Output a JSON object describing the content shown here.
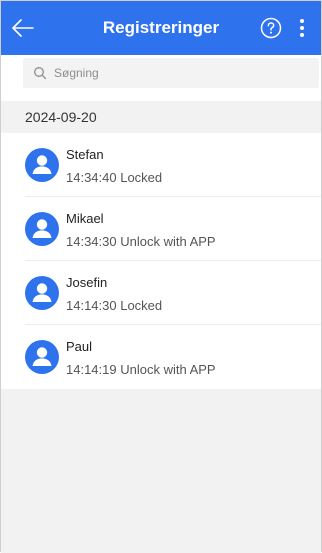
{
  "header": {
    "title": "Registreringer",
    "back_icon": "arrow-left-icon",
    "help_icon": "question-circle-icon",
    "more_icon": "more-vertical-icon",
    "background": "#2f72ee"
  },
  "search": {
    "placeholder": "Søgning",
    "value": ""
  },
  "group": {
    "date": "2024-09-20"
  },
  "records": [
    {
      "name": "Stefan",
      "detail": "14:34:40 Locked"
    },
    {
      "name": "Mikael",
      "detail": "14:34:30 Unlock with APP"
    },
    {
      "name": "Josefin",
      "detail": "14:14:30 Locked"
    },
    {
      "name": "Paul",
      "detail": "14:14:19 Unlock with APP"
    }
  ],
  "colors": {
    "accent": "#2f72ee",
    "avatar": "#2f72ee",
    "background": "#f2f2f2"
  }
}
